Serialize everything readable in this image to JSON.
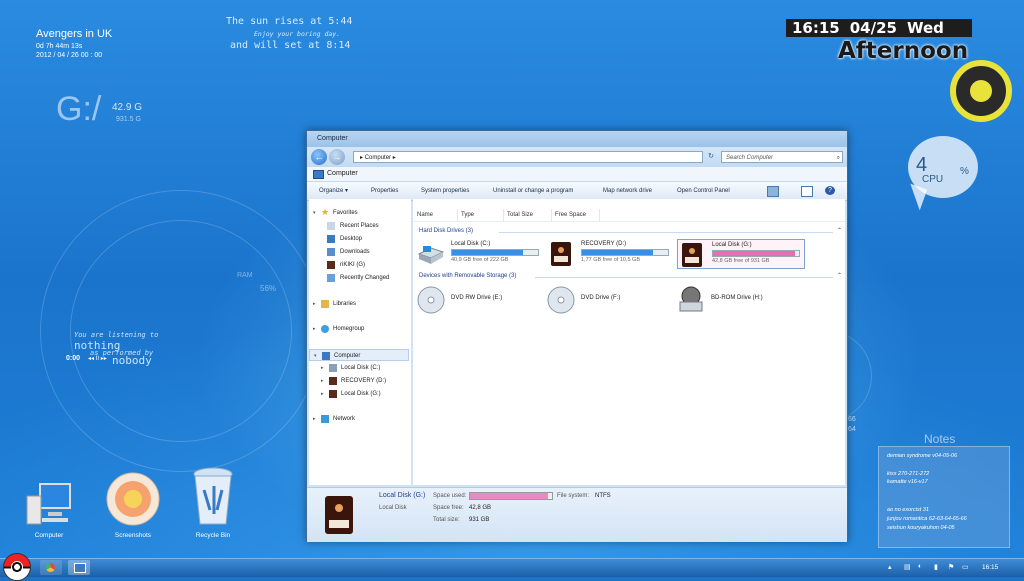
{
  "desktop": {
    "location": {
      "title": "Avengers in UK",
      "countdown": "0d 7h 44m 13s",
      "datetime": "2012 / 04 / 26   00 : 00"
    },
    "sun_quote": {
      "line1": "The sun rises at 5:44",
      "line2": "Enjoy your boring day.",
      "line3": "and will set at 8:14"
    },
    "drive_gauge": {
      "letter": "G:/",
      "used": "42.9 G",
      "total": "931.5 G"
    },
    "ram": {
      "label": "RAM",
      "value": "56%"
    },
    "music": {
      "line1": "You are listening to",
      "title": "nothing",
      "line3": "as performed by",
      "artist": "nobody",
      "time": "0:00",
      "controls": "◂◂ II ▸▸"
    },
    "clock": {
      "time": "16:15",
      "date": "04/25",
      "weekday": "Wed",
      "daypart": "Afternoon"
    },
    "cpu": {
      "value": "4",
      "label": "CPU",
      "unit": "%"
    },
    "notes": {
      "title": "Notes",
      "lines": [
        "demian syndrome v04-05-06",
        "kiss 270-271-272",
        "kamatte v16-v17",
        "ao no exorcist 31",
        "junjou romantica 62-63-64-65-66",
        "seishun kouryakuhon 04-05"
      ]
    },
    "icons": [
      {
        "label": "Computer"
      },
      {
        "label": "Screenshots"
      },
      {
        "label": "Recycle Bin"
      }
    ],
    "partial_readout": {
      "a": "66",
      "b": "64"
    }
  },
  "window": {
    "title": "Computer",
    "address": "Computer",
    "search_placeholder": "Search Computer",
    "path_label": "Computer",
    "toolbar": {
      "organize": "Organize",
      "properties": "Properties",
      "system_properties": "System properties",
      "uninstall": "Uninstall or change a program",
      "map_drive": "Map network drive",
      "control_panel": "Open Control Panel"
    },
    "nav": {
      "favorites": "Favorites",
      "recent_places": "Recent Places",
      "desktop": "Desktop",
      "downloads": "Downloads",
      "rikiki": "riKIKI (G)",
      "recently_changed": "Recently Changed",
      "libraries": "Libraries",
      "homegroup": "Homegroup",
      "computer": "Computer",
      "local_c": "Local Disk (C:)",
      "recovery_d": "RECOVERY (D:)",
      "local_g": "Local Disk (G:)",
      "network": "Network"
    },
    "columns": {
      "name": "Name",
      "type": "Type",
      "total": "Total Size",
      "free": "Free Space"
    },
    "groups": {
      "hdd": "Hard Disk Drives (3)",
      "removable": "Devices with Removable Storage (3)"
    },
    "drives": [
      {
        "name": "Local Disk (C:)",
        "free": "40,9 GB free of 222 GB",
        "used_fraction": 0.82,
        "color": "#3a8ee6"
      },
      {
        "name": "RECOVERY (D:)",
        "free": "1,77 GB free of 10,5 GB",
        "used_fraction": 0.83,
        "color": "#3a8ee6"
      },
      {
        "name": "Local Disk (G:)",
        "free": "42,8 GB free of 931 GB",
        "used_fraction": 0.95,
        "color": "#e56fb4"
      }
    ],
    "removable": [
      {
        "name": "DVD RW Drive (E:)"
      },
      {
        "name": "DVD Drive (F:)"
      },
      {
        "name": "BD-ROM Drive (H:)"
      }
    ],
    "details": {
      "name": "Local Disk (G:)",
      "type": "Local Disk",
      "space_used_label": "Space used:",
      "space_free_label": "Space free:",
      "space_free": "42,8 GB",
      "total_size_label": "Total size:",
      "total_size": "931 GB",
      "filesystem_label": "File system:",
      "filesystem": "NTFS",
      "used_fraction": 0.95
    }
  },
  "taskbar": {
    "time": "16:15"
  }
}
